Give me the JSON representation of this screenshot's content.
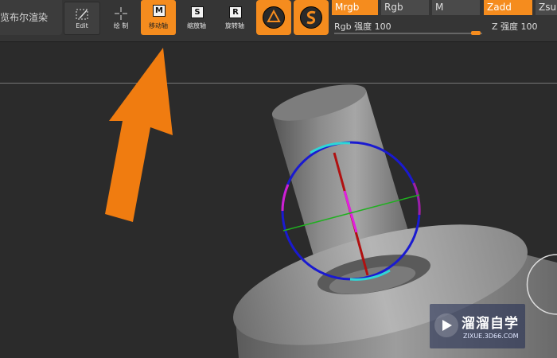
{
  "toolbar": {
    "boolean_render": "览布尔渲染",
    "edit_label": "Edit",
    "draw_label": "绘 制",
    "move_label": "移动轴",
    "move_key": "M",
    "scale_label": "缩放轴",
    "scale_key": "S",
    "rotate_label": "旋转轴",
    "rotate_key": "R",
    "channels": {
      "mrgb": "Mrgb",
      "rgb": "Rgb",
      "m": "M",
      "zadd": "Zadd",
      "zsub": "Zsub"
    },
    "rgb_intensity": "Rgb 强度 100",
    "z_intensity": "Z 强度 100"
  },
  "watermark": {
    "title": "溜溜自学",
    "url": "ZIXUE.3D66.COM"
  },
  "colors": {
    "accent": "#f58c1e",
    "background": "#2b2b2b",
    "toolbar": "#353535"
  },
  "icons": [
    "edit-icon",
    "draw-crosshair-icon",
    "move-key-icon",
    "scale-key-icon",
    "rotate-key-icon",
    "sphere-brush-icon",
    "snake-brush-icon",
    "gizmo-icon",
    "arrow-annotation"
  ]
}
